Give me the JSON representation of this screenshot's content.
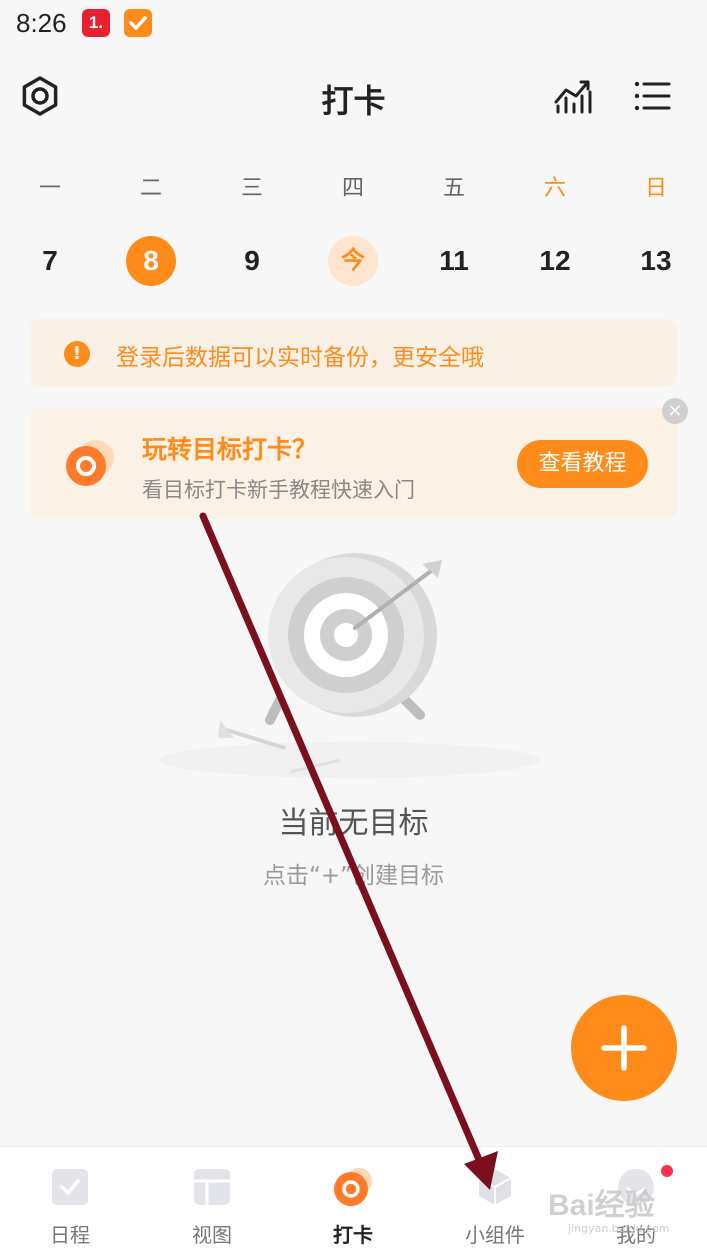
{
  "status_bar": {
    "time": "8:26",
    "app1_badge": "1."
  },
  "header": {
    "title": "打卡"
  },
  "week": {
    "days": [
      "一",
      "二",
      "三",
      "四",
      "五",
      "六",
      "日"
    ],
    "dates": [
      "7",
      "8",
      "9",
      "今",
      "11",
      "12",
      "13"
    ]
  },
  "login_banner": {
    "icon": "!",
    "text": "登录后数据可以实时备份，更安全哦"
  },
  "tutorial": {
    "title": "玩转目标打卡？",
    "subtitle": "看目标打卡新手教程快速入门",
    "button": "查看教程",
    "close": "×"
  },
  "empty_state": {
    "title": "当前无目标",
    "subtitle": "点击“+”创建目标"
  },
  "tabbar": {
    "tabs": [
      "日程",
      "视图",
      "打卡",
      "小组件",
      "我的"
    ]
  },
  "watermark": {
    "text": "Bai经验",
    "url": "jingyan.baidu.com"
  },
  "colors": {
    "accent": "#ff8c1a",
    "annotation_arrow": "#7a0f1f"
  }
}
